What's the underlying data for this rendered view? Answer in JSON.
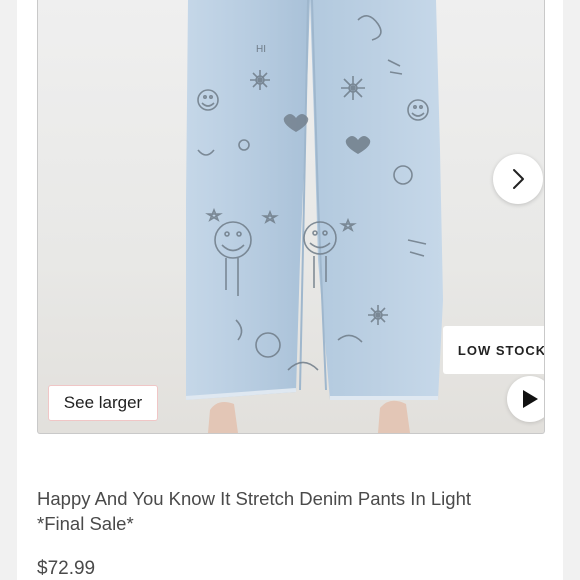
{
  "product": {
    "title_line1": "Happy And You Know It Stretch Denim Pants In Light",
    "title_line2": "*Final Sale*",
    "price": "$72.99"
  },
  "image": {
    "badge": "LOW STOCK",
    "see_larger_label": "See larger",
    "doodle_text": "HI"
  },
  "icons": {
    "next": "chevron-right-icon",
    "play": "play-icon"
  },
  "colors": {
    "denim": "#b9cfe2",
    "doodle": "#6f7c88",
    "text": "#4a4a4a",
    "badge_text": "#222222"
  }
}
